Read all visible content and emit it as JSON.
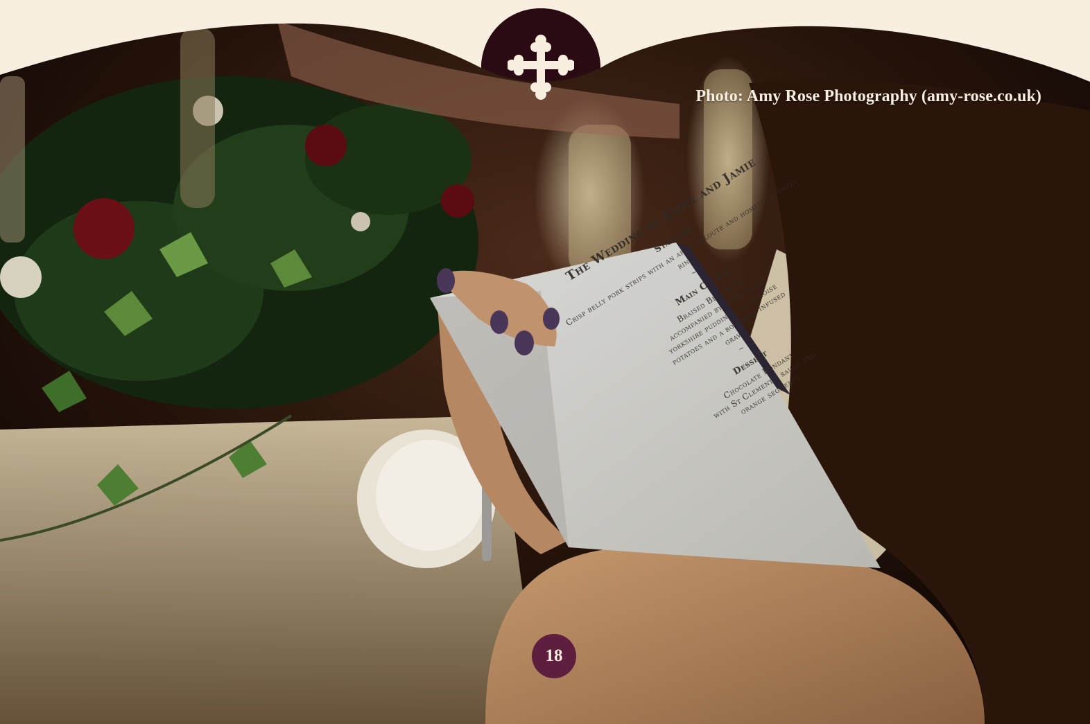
{
  "photo_credit": "Photo: Amy Rose Photography (amy-rose.co.uk)",
  "page_number": "18",
  "menu": {
    "title": "The Wedding of Emily and Jamie",
    "starters_heading": "Starters",
    "starters_text": "Crisp belly pork strips with an apple veloute and homemade onion rings",
    "sep1": "~",
    "main_heading": "Main Course",
    "main_line1": "Braised Beef Rump",
    "main_line2": "accompanied by a homemade",
    "main_line3": "yorkshire pudding, dauphinoise",
    "main_line4": "potatoes and a rosemary infused",
    "main_line5": "gravy",
    "sep2": "~",
    "dessert_heading": "Dessert",
    "dessert_line1": "Chocolate Fondant",
    "dessert_line2": "with St Clement's sauce and",
    "dessert_line3": "orange segments"
  },
  "colors": {
    "cream": "#f9efe1",
    "plum": "#5e1f3f",
    "dark_plum": "#2a0b14"
  },
  "icons": {
    "emblem": "cross-emblem-icon"
  }
}
